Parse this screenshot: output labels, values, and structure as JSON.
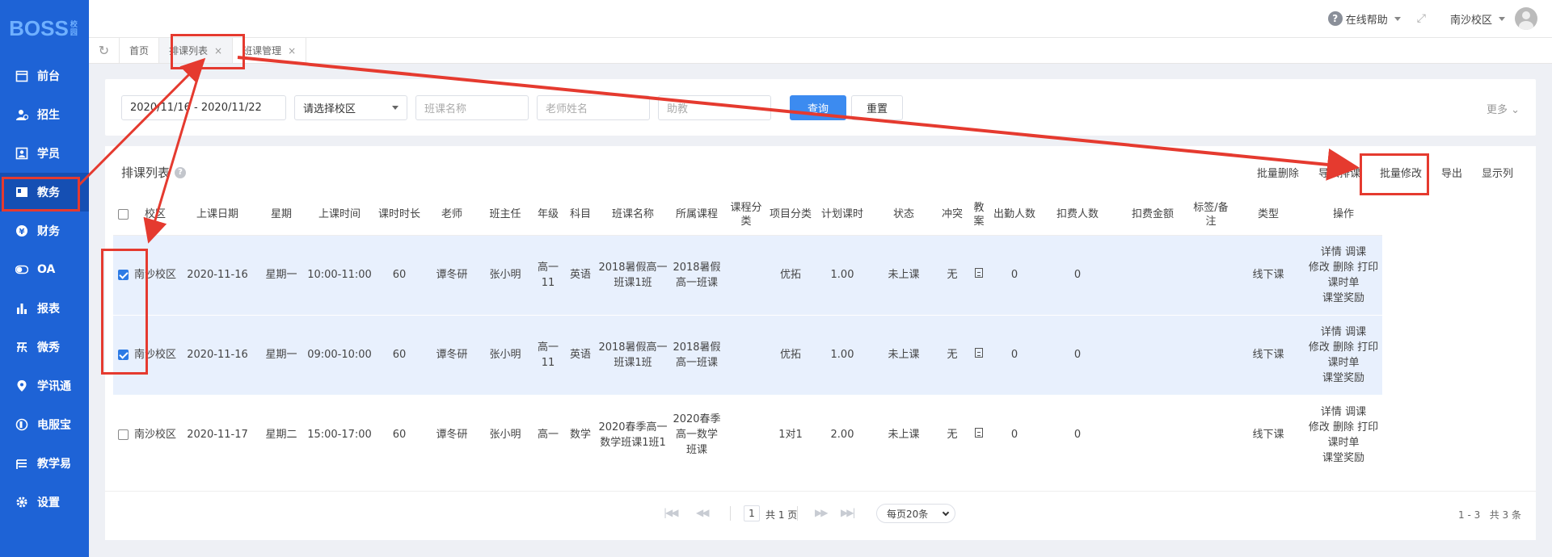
{
  "app": {
    "logo": "BOSS",
    "logo_sub": "校园"
  },
  "sidebar": {
    "items": [
      {
        "label": "前台",
        "icon": "calendar-icon"
      },
      {
        "label": "招生",
        "icon": "user-add-icon"
      },
      {
        "label": "学员",
        "icon": "student-card-icon"
      },
      {
        "label": "教务",
        "icon": "book-icon",
        "active": true
      },
      {
        "label": "财务",
        "icon": "yen-coin-icon"
      },
      {
        "label": "OA",
        "icon": "toggle-icon"
      },
      {
        "label": "报表",
        "icon": "bar-chart-icon"
      },
      {
        "label": "微秀",
        "icon": "show-icon"
      },
      {
        "label": "学讯通",
        "icon": "location-pin-icon"
      },
      {
        "label": "电服宝",
        "icon": "phone-service-icon"
      },
      {
        "label": "教学易",
        "icon": "teaching-icon"
      },
      {
        "label": "设置",
        "icon": "gear-icon"
      }
    ]
  },
  "topbar": {
    "help": "在线帮助",
    "campus": "南沙校区"
  },
  "tabs": [
    {
      "label": "首页",
      "closable": false
    },
    {
      "label": "排课列表",
      "closable": true,
      "active": true
    },
    {
      "label": "班课管理",
      "closable": true
    }
  ],
  "filters": {
    "date_range": "2020/11/16 - 2020/11/22",
    "campus_placeholder": "请选择校区",
    "class_placeholder": "班课名称",
    "teacher_placeholder": "老师姓名",
    "assistant_placeholder": "助教",
    "search": "查询",
    "reset": "重置",
    "more": "更多"
  },
  "list": {
    "title": "排课列表",
    "actions": [
      "批量删除",
      "导入排课",
      "批量修改",
      "导出",
      "显示列"
    ],
    "columns": [
      "校区",
      "上课日期",
      "星期",
      "上课时间",
      "课时时长",
      "老师",
      "班主任",
      "年级",
      "科目",
      "班课名称",
      "所属课程",
      "课程分类",
      "项目分类",
      "计划课时",
      "状态",
      "冲突",
      "教案",
      "出勤人数",
      "扣费人数",
      "扣费金额",
      "标签/备注",
      "类型",
      "操作"
    ],
    "rows": [
      {
        "checked": true,
        "campus": "南沙校区",
        "date": "2020-11-16",
        "weekday": "星期一",
        "time": "10:00-11:00",
        "duration": "60",
        "teacher": "谭冬研",
        "head": "张小明",
        "grade": "高一11",
        "subject": "英语",
        "class": "2018暑假高一班课1班",
        "course": "2018暑假高一班课",
        "course_cat": "",
        "project": "优拓",
        "hours": "1.00",
        "status": "未上课",
        "conflict": "无",
        "attend": "0",
        "charged": "0",
        "amount": "",
        "tag": "",
        "type": "线下课"
      },
      {
        "checked": true,
        "campus": "南沙校区",
        "date": "2020-11-16",
        "weekday": "星期一",
        "time": "09:00-10:00",
        "duration": "60",
        "teacher": "谭冬研",
        "head": "张小明",
        "grade": "高一11",
        "subject": "英语",
        "class": "2018暑假高一班课1班",
        "course": "2018暑假高一班课",
        "course_cat": "",
        "project": "优拓",
        "hours": "1.00",
        "status": "未上课",
        "conflict": "无",
        "attend": "0",
        "charged": "0",
        "amount": "",
        "tag": "",
        "type": "线下课"
      },
      {
        "checked": false,
        "campus": "南沙校区",
        "date": "2020-11-17",
        "weekday": "星期二",
        "time": "15:00-17:00",
        "duration": "60",
        "teacher": "谭冬研",
        "head": "张小明",
        "grade": "高一",
        "subject": "数学",
        "class": "2020春季高一数学班课1班1",
        "course": "2020春季高一数学班课",
        "course_cat": "",
        "project": "1对1",
        "hours": "2.00",
        "status": "未上课",
        "conflict": "无",
        "attend": "0",
        "charged": "0",
        "amount": "",
        "tag": "",
        "type": "线下课"
      }
    ],
    "ops": [
      "详情",
      "调课",
      "修改",
      "删除",
      "打印课时单",
      "课堂奖励"
    ]
  },
  "pager": {
    "page": "1",
    "total_pages": "共 1 页",
    "page_size": "每页20条",
    "range": "1 - 3",
    "total": "共 3 条"
  },
  "colors": {
    "sidebar": "#1e63d6",
    "primary": "#3c8bf0",
    "link": "#2d7be5",
    "highlight": "#e53a2f"
  }
}
